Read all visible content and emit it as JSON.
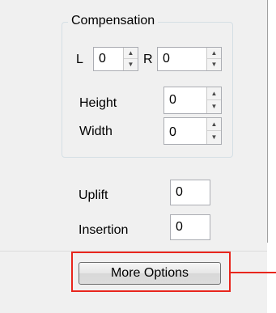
{
  "compensation": {
    "title": "Compensation",
    "left_label": "L",
    "left_value": "0",
    "right_label": "R",
    "right_value": "0",
    "height_label": "Height",
    "height_value": "0",
    "width_label": "Width",
    "width_value": "0"
  },
  "uplift": {
    "label": "Uplift",
    "value": "0"
  },
  "insertion": {
    "label": "Insertion",
    "value": "0"
  },
  "more_options_label": "More Options",
  "icons": {
    "spin_up": "▲",
    "spin_down": "▼"
  },
  "colors": {
    "highlight": "#e8261d",
    "panel_bg": "#f0f0f0"
  }
}
